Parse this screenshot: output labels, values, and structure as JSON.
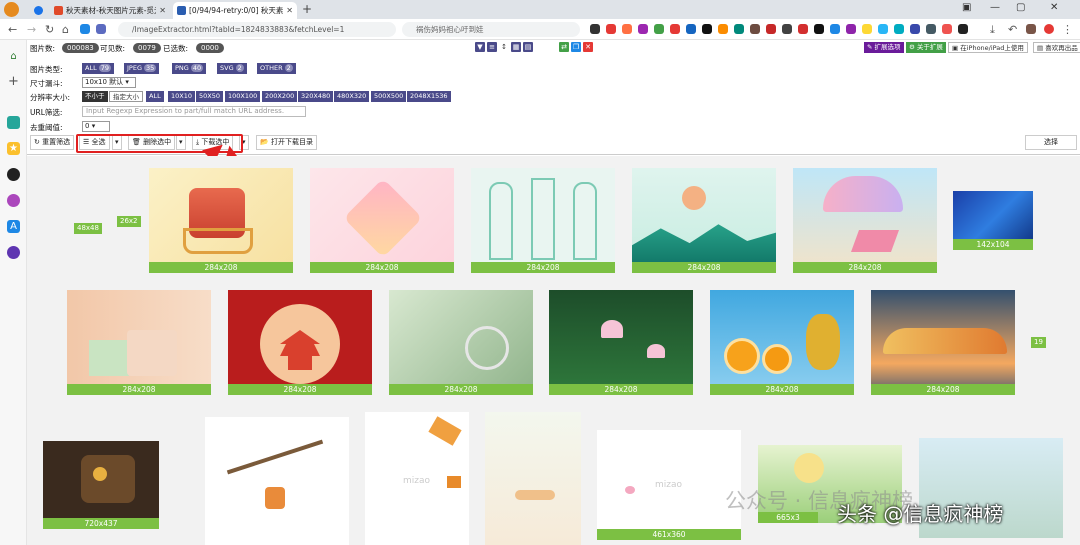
{
  "tabs": [
    {
      "title": "秋天素材-秋天图片元素-觅元素"
    },
    {
      "title": "[0/94/94-retry:0/0] 秋天素材"
    }
  ],
  "address": {
    "url": "/ImageExtractor.html?tabId=1824833883&fetchLevel=1",
    "search": "祸伤妈妈祖心吁到娃"
  },
  "toolbar": {
    "image_count_label": "图片数:",
    "image_count": "000083",
    "visible_label": "可见数:",
    "visible_count": "0079",
    "selected_label": "已选数:",
    "selected_count": "0000",
    "ext_options": "扩展选项",
    "about": "关于扩展",
    "iphone": "在iPhone/iPad上使用",
    "tips": "喜欢再出品"
  },
  "filters": {
    "type_label": "图片类型:",
    "types": [
      {
        "name": "ALL",
        "count": "79"
      },
      {
        "name": "JPEG",
        "count": "35"
      },
      {
        "name": "PNG",
        "count": "40"
      },
      {
        "name": "SVG",
        "count": "2"
      },
      {
        "name": "OTHER",
        "count": "2"
      }
    ],
    "size_label": "尺寸漏斗:",
    "size_value": "10x10 默认",
    "res_label": "分辨率大小:",
    "res_options": [
      "不小于",
      "指定大小",
      "ALL",
      "10X10",
      "50X50",
      "100X100",
      "200X200",
      "320X480",
      "480X320",
      "500X500",
      "2048X1536"
    ],
    "url_label": "URL筛选:",
    "url_placeholder": "Input Regexp Expression to part/full match URL address.",
    "dedupe_label": "去重阈值:",
    "dedupe_value": "0"
  },
  "actions": {
    "reset": "重置筛选",
    "select_all": "全选",
    "delete_selected": "删除选中",
    "download_selected": "下载选中",
    "open_dir": "打开下载目录",
    "select": "选择"
  },
  "images": [
    {
      "label": "48x48"
    },
    {
      "label": "26x2"
    },
    {
      "label": "284x208"
    },
    {
      "label": "284x208"
    },
    {
      "label": "284x208"
    },
    {
      "label": "284x208"
    },
    {
      "label": "284x208"
    },
    {
      "label": "142x104"
    },
    {
      "label": "284x208"
    },
    {
      "label": "284x208"
    },
    {
      "label": "284x208"
    },
    {
      "label": "284x208"
    },
    {
      "label": "284x208"
    },
    {
      "label": "284x208"
    },
    {
      "label": "19"
    },
    {
      "label": "720x437"
    },
    {
      "label": "461x360"
    },
    {
      "label": "665x3"
    }
  ],
  "watermarks": {
    "wechat": "公众号 · 信息疯神榜",
    "toutiao": "头条 @信息疯神榜",
    "mizao": "mizao"
  },
  "colors": {
    "accent_green": "#7cc043",
    "highlight_red": "#e02020",
    "chip_purple": "#4a4a8a"
  }
}
